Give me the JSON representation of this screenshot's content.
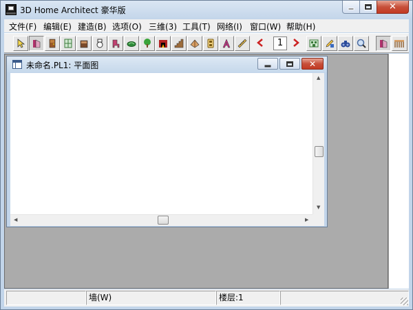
{
  "window": {
    "title": "3D Home Architect 豪华版"
  },
  "menu": {
    "items": [
      {
        "label": "文件(F)"
      },
      {
        "label": "编辑(E)"
      },
      {
        "label": "建造(B)"
      },
      {
        "label": "选项(O)"
      },
      {
        "label": "三维(3)"
      },
      {
        "label": "工具(T)"
      },
      {
        "label": "网络(I)"
      },
      {
        "label": "窗口(W)"
      },
      {
        "label": "帮助(H)"
      }
    ]
  },
  "toolbar": {
    "floor_number": "1",
    "buttons": [
      {
        "icon": "select-arrow-icon",
        "color": "#f7d94c"
      },
      {
        "icon": "wall-tool-icon",
        "color": "#b0306b",
        "pressed": true
      },
      {
        "icon": "door-icon",
        "color": "#9a5a2a"
      },
      {
        "icon": "window-icon",
        "color": "#3c7a3c"
      },
      {
        "icon": "cabinet-icon",
        "color": "#7a4a2a"
      },
      {
        "icon": "toilet-icon",
        "color": "#ffffff"
      },
      {
        "icon": "chair-icon",
        "color": "#c04070"
      },
      {
        "icon": "plant-bed-icon",
        "color": "#2e8b3a"
      },
      {
        "icon": "tree-icon",
        "color": "#3aa43a"
      },
      {
        "icon": "fireplace-icon",
        "color": "#b22222"
      },
      {
        "icon": "stairs-icon",
        "color": "#9c6b3a"
      },
      {
        "icon": "roof-icon",
        "color": "#d9a066"
      },
      {
        "icon": "electrical-icon",
        "color": "#c09030"
      },
      {
        "icon": "text-tool-icon",
        "color": "#c03080"
      },
      {
        "icon": "dimension-ruler-icon",
        "color": "#d8b04a"
      },
      {
        "icon": "floor-down-icon",
        "color": "#cc2222"
      },
      {
        "icon": "floor-up-icon",
        "color": "#cc2222"
      },
      {
        "icon": "elevation-view-icon",
        "color": "#3a7a3a"
      },
      {
        "icon": "pencil-materials-icon",
        "color": "#3a6ac0"
      },
      {
        "icon": "binoculars-icon",
        "color": "#2a4a9a"
      },
      {
        "icon": "zoom-magnifier-icon",
        "color": "#4a6aa0"
      },
      {
        "icon": "wall-3d-icon",
        "color": "#b0306b",
        "pressed": true
      },
      {
        "icon": "railing-icon",
        "color": "#8a5a2a"
      }
    ]
  },
  "child_window": {
    "title": "未命名.PL1: 平面图"
  },
  "status": {
    "panes": [
      {
        "text": ""
      },
      {
        "text": "墙(W)"
      },
      {
        "text": "楼层:1"
      },
      {
        "text": ""
      }
    ]
  }
}
